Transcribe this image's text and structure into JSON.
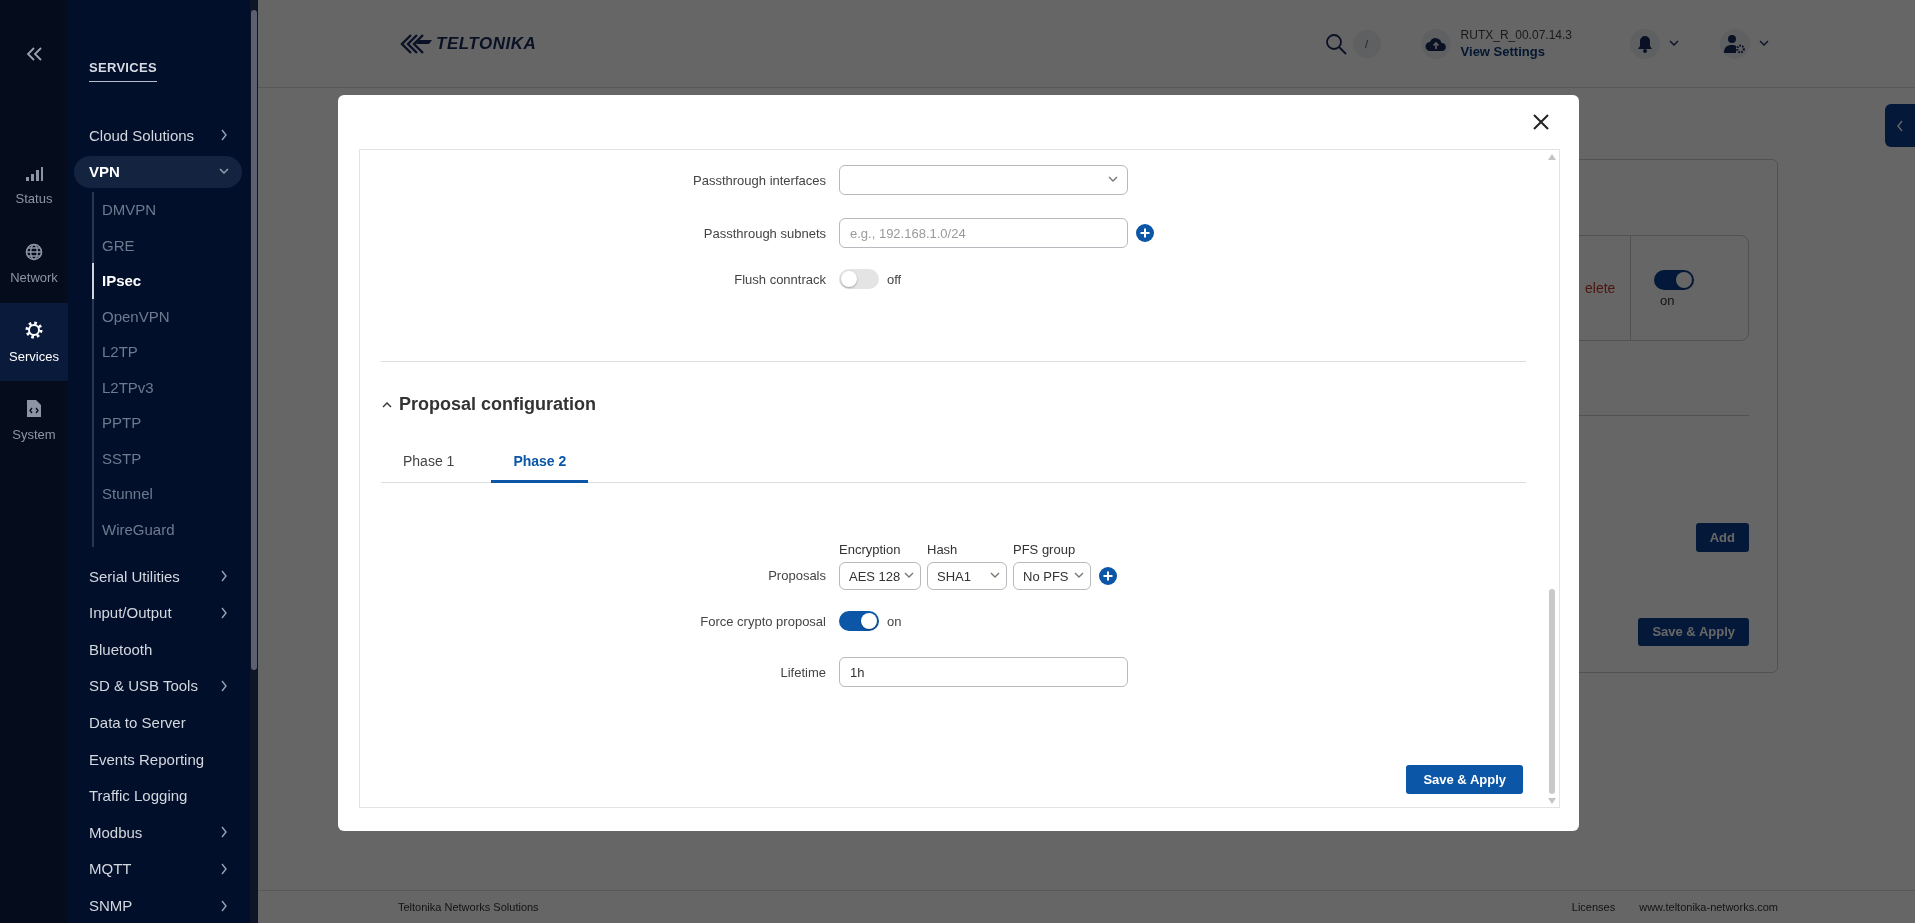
{
  "sidebar": {
    "rail": [
      {
        "label": "Status",
        "selected": false
      },
      {
        "label": "Network",
        "selected": false
      },
      {
        "label": "Services",
        "selected": true
      },
      {
        "label": "System",
        "selected": false
      }
    ],
    "section_title": "SERVICES",
    "menu": [
      {
        "label": "Cloud Solutions",
        "submenu": true,
        "expanded": false,
        "selected": false
      },
      {
        "label": "VPN",
        "submenu": true,
        "expanded": true,
        "selected": true,
        "children": [
          {
            "label": "DMVPN",
            "selected": false
          },
          {
            "label": "GRE",
            "selected": false
          },
          {
            "label": "IPsec",
            "selected": true
          },
          {
            "label": "OpenVPN",
            "selected": false
          },
          {
            "label": "L2TP",
            "selected": false
          },
          {
            "label": "L2TPv3",
            "selected": false
          },
          {
            "label": "PPTP",
            "selected": false
          },
          {
            "label": "SSTP",
            "selected": false
          },
          {
            "label": "Stunnel",
            "selected": false
          },
          {
            "label": "WireGuard",
            "selected": false
          }
        ]
      },
      {
        "label": "Serial Utilities",
        "submenu": true,
        "expanded": false,
        "selected": false
      },
      {
        "label": "Input/Output",
        "submenu": true,
        "expanded": false,
        "selected": false
      },
      {
        "label": "Bluetooth",
        "submenu": false,
        "selected": false
      },
      {
        "label": "SD & USB Tools",
        "submenu": true,
        "expanded": false,
        "selected": false
      },
      {
        "label": "Data to Server",
        "submenu": false,
        "selected": false
      },
      {
        "label": "Events Reporting",
        "submenu": false,
        "selected": false
      },
      {
        "label": "Traffic Logging",
        "submenu": false,
        "selected": false
      },
      {
        "label": "Modbus",
        "submenu": true,
        "expanded": false,
        "selected": false
      },
      {
        "label": "MQTT",
        "submenu": true,
        "expanded": false,
        "selected": false
      },
      {
        "label": "SNMP",
        "submenu": true,
        "expanded": false,
        "selected": false
      }
    ]
  },
  "header": {
    "logo": "TELTONIKA",
    "search_shortcut": "/",
    "firmware": "RUTX_R_00.07.14.3",
    "settings_link": "View Settings"
  },
  "background_page": {
    "delete_link": "elete",
    "toggle": {
      "on": true,
      "state_label": "on"
    },
    "add_button": "Add",
    "save_button": "Save & Apply"
  },
  "modal": {
    "fields": [
      {
        "kind": "select",
        "label": "Passthrough interfaces"
      },
      {
        "kind": "text",
        "label": "Passthrough subnets",
        "placeholder": "e.g., 192.168.1.0/24",
        "addable": true
      },
      {
        "kind": "toggle",
        "label": "Flush conntrack",
        "on": false,
        "state_label": "off"
      }
    ],
    "section": {
      "title": "Proposal configuration",
      "expanded": true,
      "tabs": [
        {
          "label": "Phase 1",
          "selected": false
        },
        {
          "label": "Phase 2",
          "selected": true
        }
      ],
      "fields": [
        {
          "kind": "proposals",
          "label": "Proposals",
          "addable": true,
          "columns": [
            {
              "heading": "Encryption",
              "value": "AES 128"
            },
            {
              "heading": "Hash",
              "value": "SHA1"
            },
            {
              "heading": "PFS group",
              "value": "No PFS"
            }
          ]
        },
        {
          "kind": "toggle",
          "label": "Force crypto proposal",
          "on": true,
          "state_label": "on"
        },
        {
          "kind": "text",
          "label": "Lifetime",
          "value": "1h"
        }
      ]
    },
    "save_button": "Save & Apply"
  },
  "footer": {
    "company": "Teltonika Networks Solutions",
    "links": [
      "Licenses",
      "www.teltonika-networks.com"
    ]
  }
}
